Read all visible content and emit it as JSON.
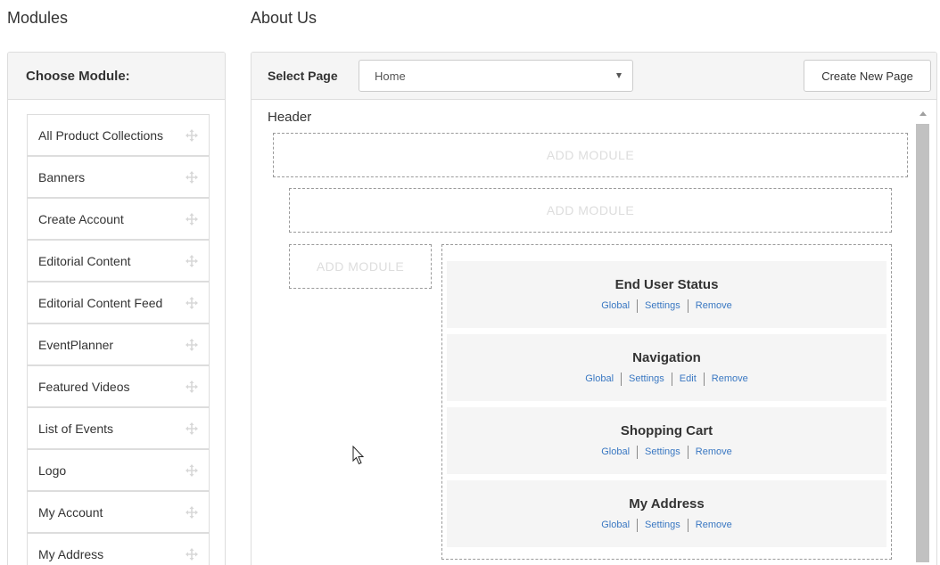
{
  "modules_title": "Modules",
  "page_title": "About Us",
  "left_panel": {
    "header": "Choose Module:",
    "items": [
      "All Product Collections",
      "Banners",
      "Create Account",
      "Editorial Content",
      "Editorial Content Feed",
      "EventPlanner",
      "Featured Videos",
      "List of Events",
      "Logo",
      "My Account",
      "My Address"
    ]
  },
  "right_panel": {
    "select_label": "Select Page",
    "select_value": "Home",
    "create_button": "Create New Page",
    "header_label": "Header",
    "add_module_label": "ADD MODULE",
    "modules": [
      {
        "name": "End User Status",
        "actions": [
          "Global",
          "Settings",
          "Remove"
        ]
      },
      {
        "name": "Navigation",
        "actions": [
          "Global",
          "Settings",
          "Edit",
          "Remove"
        ]
      },
      {
        "name": "Shopping Cart",
        "actions": [
          "Global",
          "Settings",
          "Remove"
        ]
      },
      {
        "name": "My Address",
        "actions": [
          "Global",
          "Settings",
          "Remove"
        ]
      }
    ]
  },
  "colors": {
    "link": "#3a78c2",
    "panel_header_bg": "#f5f5f5",
    "border": "#dddddd",
    "drop_zone_text": "#dddddd"
  },
  "icons": {
    "drag_handle": "move-arrows-icon",
    "select_arrow": "caret-down-icon",
    "scroll_up": "scroll-up-arrow-icon",
    "cursor": "mouse-pointer-icon"
  }
}
